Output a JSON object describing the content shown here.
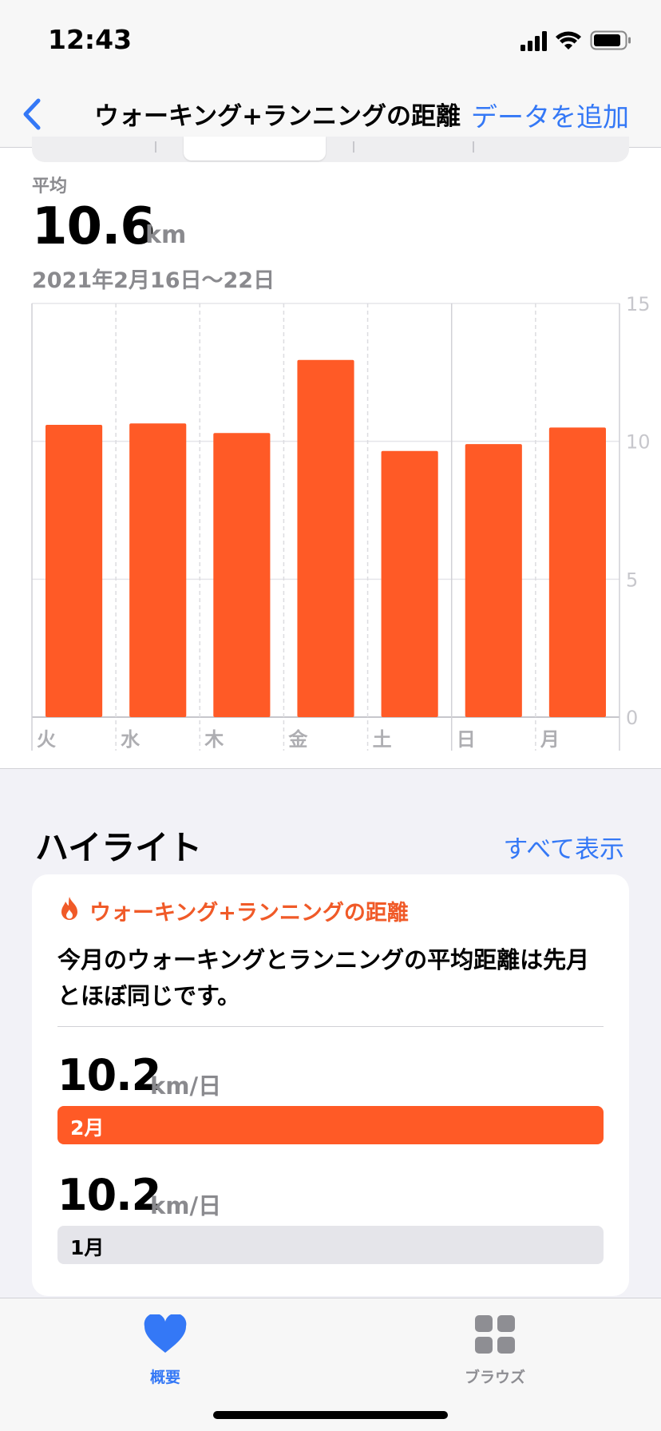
{
  "status_bar": {
    "time": "12:43"
  },
  "nav": {
    "title": "ウォーキング+ランニングの距離",
    "action": "データを追加"
  },
  "summary": {
    "label": "平均",
    "value": "10.6",
    "unit": "km",
    "date_range": "2021年2月16日〜22日"
  },
  "chart_data": {
    "type": "bar",
    "categories": [
      "火",
      "水",
      "木",
      "金",
      "土",
      "日",
      "月"
    ],
    "values": [
      10.6,
      10.65,
      10.3,
      12.95,
      9.65,
      9.9,
      10.5
    ],
    "ylim": [
      0,
      15
    ],
    "y_ticks": [
      "0",
      "5",
      "10",
      "15"
    ],
    "bar_color": "#ff5a26",
    "grid": true
  },
  "highlights": {
    "title": "ハイライト",
    "show_all": "すべて表示",
    "card": {
      "category": "ウォーキング+ランニングの距離",
      "text": "今月のウォーキングとランニングの平均距離は先月とほぼ同じです。",
      "stats": [
        {
          "value": "10.2",
          "unit": "km/日",
          "label": "2月",
          "color": "#ff5a26"
        },
        {
          "value": "10.2",
          "unit": "km/日",
          "label": "1月",
          "color": "#e5e5ea"
        }
      ]
    }
  },
  "tab_bar": {
    "tabs": [
      {
        "label": "概要",
        "active": true
      },
      {
        "label": "ブラウズ",
        "active": false
      }
    ]
  },
  "colors": {
    "accent": "#3478f6",
    "orange": "#ff5a26",
    "category_orange": "#f05a28"
  }
}
